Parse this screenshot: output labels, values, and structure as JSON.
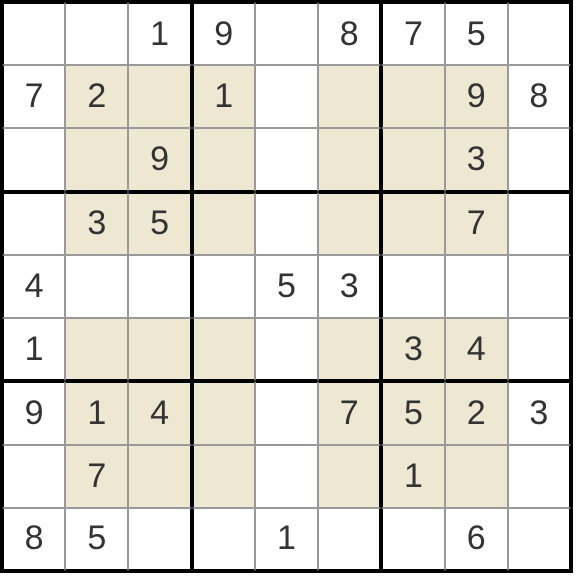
{
  "sudoku": {
    "grid": [
      [
        "",
        "",
        "1",
        "9",
        "",
        "8",
        "7",
        "5",
        ""
      ],
      [
        "7",
        "2",
        "",
        "1",
        "",
        "",
        "",
        "9",
        "8"
      ],
      [
        "",
        "",
        "9",
        "",
        "",
        "",
        "",
        "3",
        ""
      ],
      [
        "",
        "3",
        "5",
        "",
        "",
        "",
        "",
        "7",
        ""
      ],
      [
        "4",
        "",
        "",
        "",
        "5",
        "3",
        "",
        "",
        ""
      ],
      [
        "1",
        "",
        "",
        "",
        "",
        "",
        "3",
        "4",
        ""
      ],
      [
        "9",
        "1",
        "4",
        "",
        "",
        "7",
        "5",
        "2",
        "3"
      ],
      [
        "",
        "7",
        "",
        "",
        "",
        "",
        "1",
        "",
        ""
      ],
      [
        "8",
        "5",
        "",
        "",
        "1",
        "",
        "",
        "6",
        ""
      ]
    ],
    "shaded_pattern": "diagonal-boxes",
    "colors": {
      "shaded_bg": "#eee8d3",
      "normal_bg": "#ffffff",
      "text": "#333333",
      "thin_border": "#999999",
      "thick_border": "#000000"
    }
  }
}
